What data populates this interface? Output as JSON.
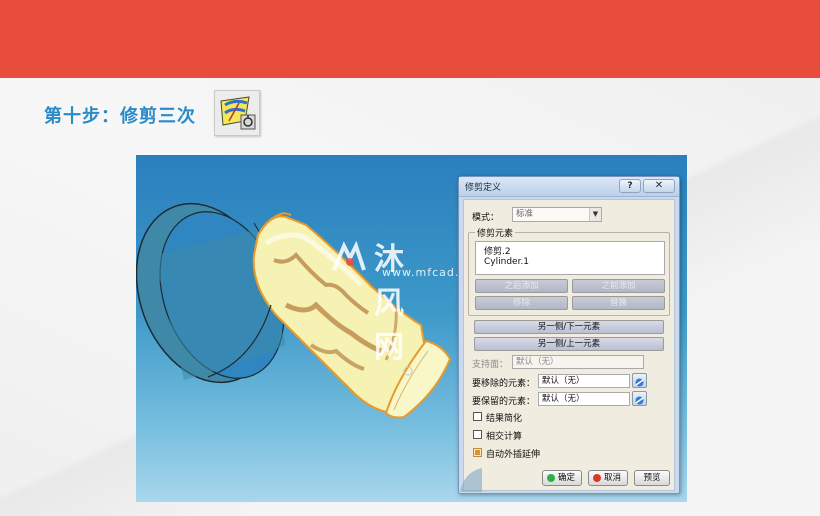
{
  "header": {
    "step_title": "第十步：修剪三次",
    "banner_color": "#e84c3d",
    "title_color": "#2a8bc8"
  },
  "toolbar_icon": {
    "name": "trim-icon"
  },
  "watermark": {
    "main": "沐风网",
    "sub": "www.mfcad.com"
  },
  "dialog": {
    "title": "修剪定义",
    "help_label": "?",
    "close_label": "✕",
    "mode_label": "模式：",
    "mode_value": "标准",
    "group_label": "修剪元素",
    "elements": [
      "修剪.2",
      "Cylinder.1"
    ],
    "btn_insert_after": "之后添加",
    "btn_insert_before": "之前添加",
    "btn_remove": "移除",
    "btn_replace": "替换",
    "btn_other_side_next": "另一侧/下一元素",
    "btn_other_side_prev": "另一侧/上一元素",
    "support_label": "支持面：",
    "support_value": "默认（无）",
    "remove_label": "要移除的元素：",
    "remove_value": "默认（无）",
    "keep_label": "要保留的元素：",
    "keep_value": "默认（无）",
    "chk_simplify": "结果简化",
    "chk_intersect": "相交计算",
    "chk_extrapolate": "自动外插延伸",
    "ok_label": "确定",
    "cancel_label": "取消",
    "preview_label": "预览"
  }
}
